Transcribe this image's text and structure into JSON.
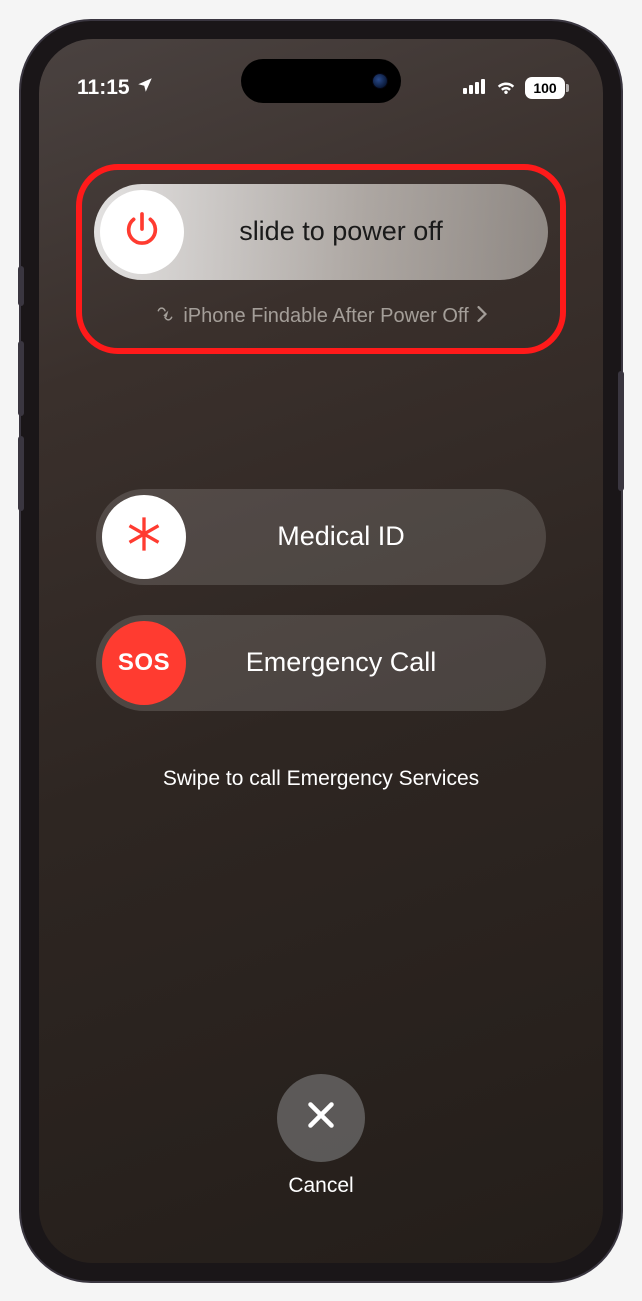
{
  "status": {
    "time": "11:15",
    "battery": "100"
  },
  "power": {
    "slide_label": "slide to power off",
    "findable_label": "iPhone Findable After Power Off"
  },
  "medical": {
    "label": "Medical ID"
  },
  "sos": {
    "knob_label": "SOS",
    "label": "Emergency Call",
    "hint": "Swipe to call Emergency Services"
  },
  "cancel": {
    "label": "Cancel"
  }
}
